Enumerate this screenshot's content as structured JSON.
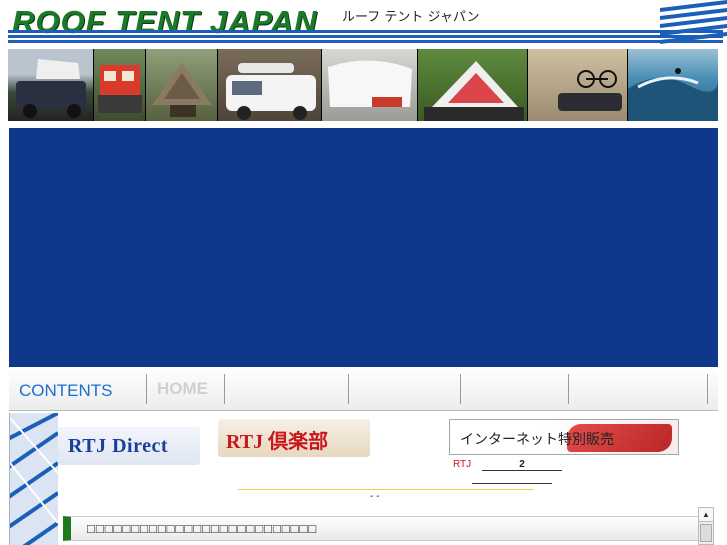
{
  "header": {
    "logo": "ROOF TENT JAPAN",
    "logo_kana": "ルーフ テント ジャパン"
  },
  "photos": [
    {
      "name": "suv-with-roof-tent"
    },
    {
      "name": "red-roof-tent-open"
    },
    {
      "name": "white-car-roof-box"
    },
    {
      "name": "white-roof-tent-closed"
    },
    {
      "name": "green-roof-tent-open"
    },
    {
      "name": "bicycle-on-roof"
    },
    {
      "name": "surfer-wave"
    }
  ],
  "nav": {
    "contents_label": "CONTENTS",
    "home_label": "HOME"
  },
  "promo": {
    "rtj_direct": "RTJ Direct",
    "rtj_club": "RTJ 倶楽部",
    "net_sale": "インターネット特別販売",
    "rtj_short": "RTJ",
    "line_number": "2",
    "dots": "-    -"
  },
  "notice": {
    "text": "□□□□□□□□□□□□□□□□□□□□□□□□□□"
  },
  "colors": {
    "banner": "#10388a",
    "logo_green": "#1a7a2a",
    "accent_blue": "#1c6fd0",
    "accent_red": "#c8181e"
  }
}
